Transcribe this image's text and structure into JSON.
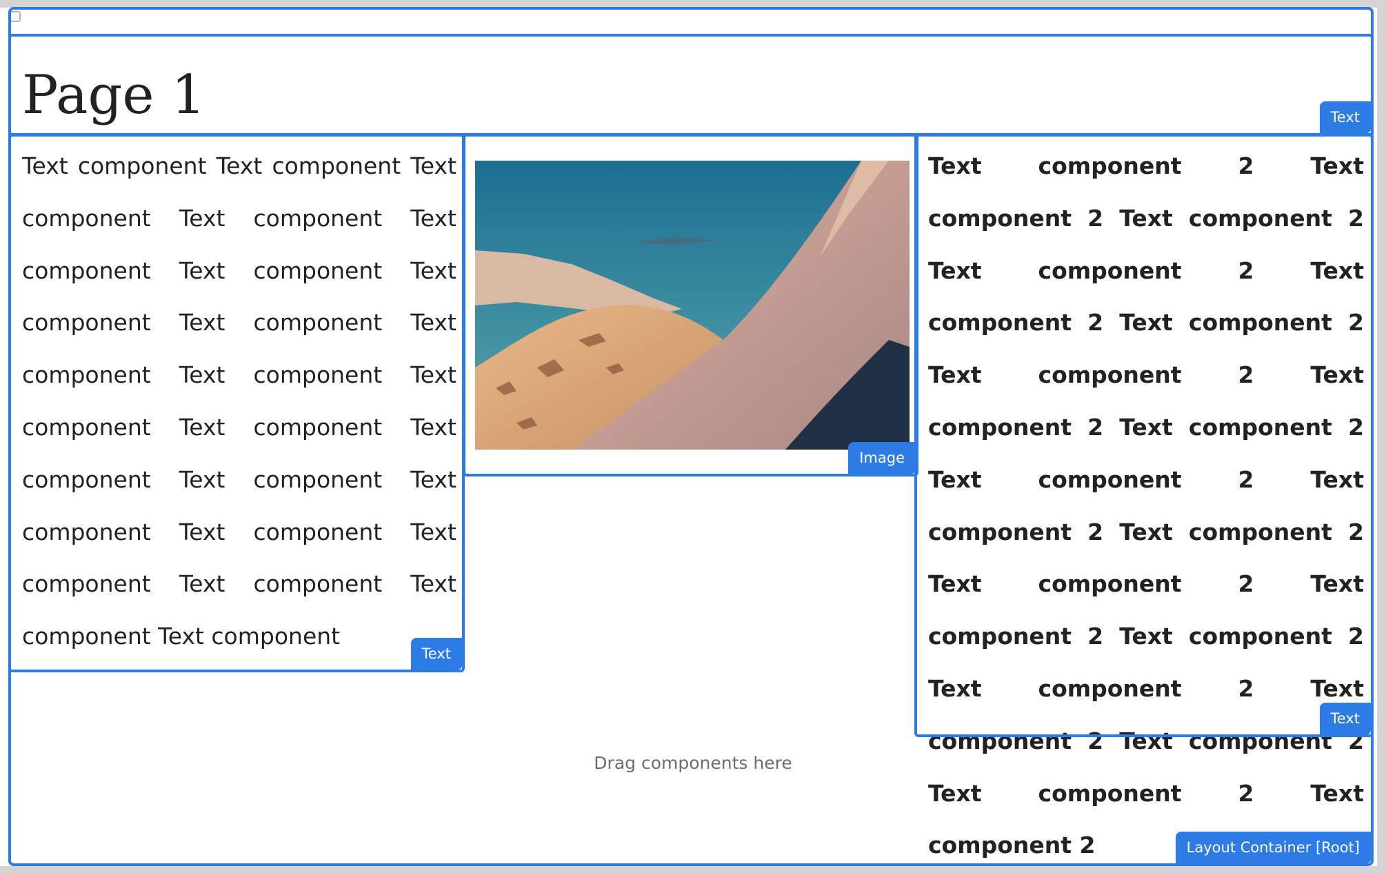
{
  "page": {
    "title": "Page 1"
  },
  "components": {
    "page_title_badge": "Text",
    "text1": {
      "content": "Text component Text component Text component Text component Text component Text component Text component Text component Text component Text component Text component Text component Text component Text component Text component Text component Text component Text component Text component Text component",
      "badge": "Text"
    },
    "image": {
      "badge": "Image",
      "subject": "snowy mountain ridge at sunset"
    },
    "text2": {
      "content": "Text component 2 Text component 2 Text component 2 Text component 2 Text component 2 Text component 2 Text component 2 Text component 2 Text component 2 Text component 2 Text component 2 Text component 2 Text component 2 Text component 2 Text component 2 Text component 2 Text component 2 Text component 2 Text component 2 Text component 2",
      "badge": "Text"
    }
  },
  "drop_zone": {
    "hint": "Drag components here"
  },
  "root": {
    "badge": "Layout Container [Root]"
  },
  "colors": {
    "accent": "#2d7be5",
    "text": "#222222",
    "hint": "#6d6d6d"
  }
}
